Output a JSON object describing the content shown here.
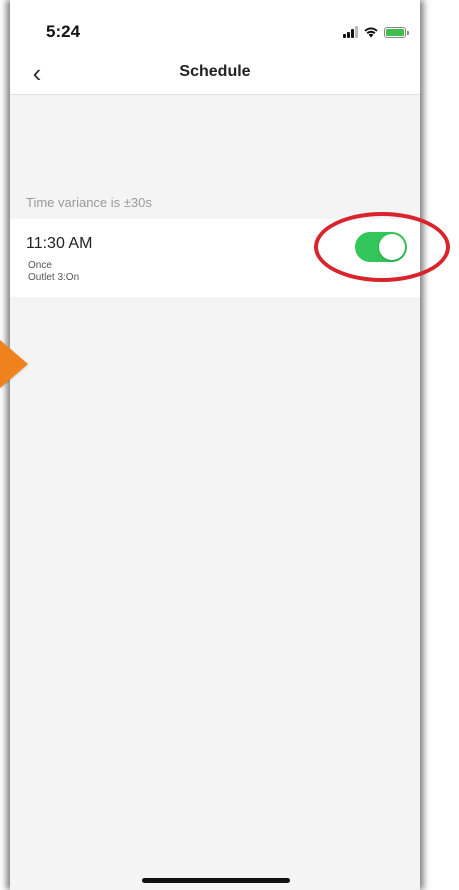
{
  "status_bar": {
    "time": "5:24",
    "icons": [
      "signal-icon",
      "wifi-icon",
      "battery-charging-icon"
    ],
    "battery_color": "#3cc04a"
  },
  "nav": {
    "back_icon": "chevron-left-icon",
    "back_glyph": "‹",
    "title": "Schedule"
  },
  "schedule": {
    "variance_note": "Time variance is  ±30s",
    "items": [
      {
        "time": "11:30 AM",
        "repeat": "Once",
        "action": "Outlet 3:On",
        "enabled": true
      }
    ],
    "toggle_on_color": "#33c65a"
  },
  "annotations": {
    "highlight_color": "#d9242b",
    "arrow_color": "#f0821e"
  }
}
